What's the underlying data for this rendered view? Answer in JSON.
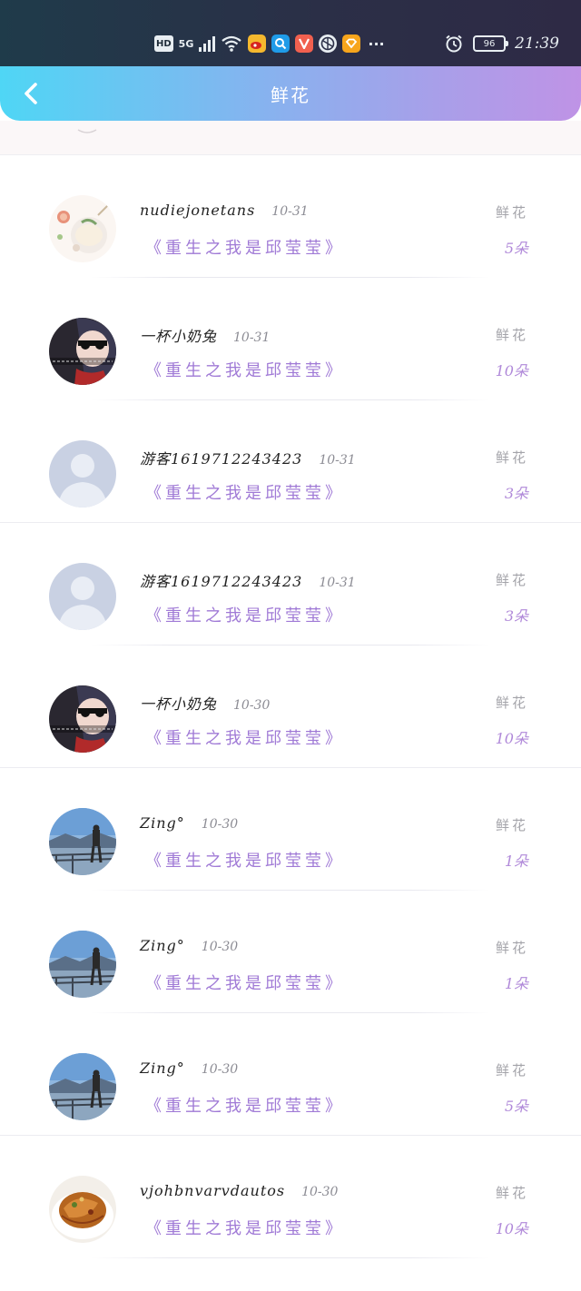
{
  "status_bar": {
    "hd": "HD",
    "net": "5G",
    "battery": "96",
    "time": "21:39",
    "icons": [
      "hd-icon",
      "signal-icon",
      "wifi-icon",
      "weibo-icon",
      "search-app-icon",
      "video-app-icon",
      "browser-icon",
      "shop-app-icon",
      "more-icon",
      "alarm-icon",
      "battery-icon"
    ],
    "more": "···"
  },
  "header": {
    "title": "鲜花",
    "back_icon": "chevron-left-icon",
    "gradient_start": "#4fd6f5",
    "gradient_end": "#bf93e6"
  },
  "colors": {
    "book_title": "#a07ad6",
    "count": "#b089d9",
    "label": "#a4a4aa"
  },
  "records": [
    {
      "name": "nudiejonetans",
      "date": "10-31",
      "book": "《重生之我是邱莹莹》",
      "gift": "鲜花",
      "count": "5朵",
      "avatar": "food-avatar"
    },
    {
      "name": "一杯小奶兔",
      "date": "10-31",
      "book": "《重生之我是邱莹莹》",
      "gift": "鲜花",
      "count": "10朵",
      "avatar": "anime-avatar"
    },
    {
      "name": "游客1619712243423",
      "date": "10-31",
      "book": "《重生之我是邱莹莹》",
      "gift": "鲜花",
      "count": "3朵",
      "avatar": "default-avatar"
    },
    {
      "name": "游客1619712243423",
      "date": "10-31",
      "book": "《重生之我是邱莹莹》",
      "gift": "鲜花",
      "count": "3朵",
      "avatar": "default-avatar"
    },
    {
      "name": "一杯小奶兔",
      "date": "10-30",
      "book": "《重生之我是邱莹莹》",
      "gift": "鲜花",
      "count": "10朵",
      "avatar": "anime-avatar"
    },
    {
      "name": "Zing°",
      "date": "10-30",
      "book": "《重生之我是邱莹莹》",
      "gift": "鲜花",
      "count": "1朵",
      "avatar": "scenery-avatar"
    },
    {
      "name": "Zing°",
      "date": "10-30",
      "book": "《重生之我是邱莹莹》",
      "gift": "鲜花",
      "count": "1朵",
      "avatar": "scenery-avatar"
    },
    {
      "name": "Zing°",
      "date": "10-30",
      "book": "《重生之我是邱莹莹》",
      "gift": "鲜花",
      "count": "5朵",
      "avatar": "scenery-avatar"
    },
    {
      "name": "vjohbnvarvdautos",
      "date": "10-30",
      "book": "《重生之我是邱莹莹》",
      "gift": "鲜花",
      "count": "10朵",
      "avatar": "dish-avatar"
    }
  ]
}
